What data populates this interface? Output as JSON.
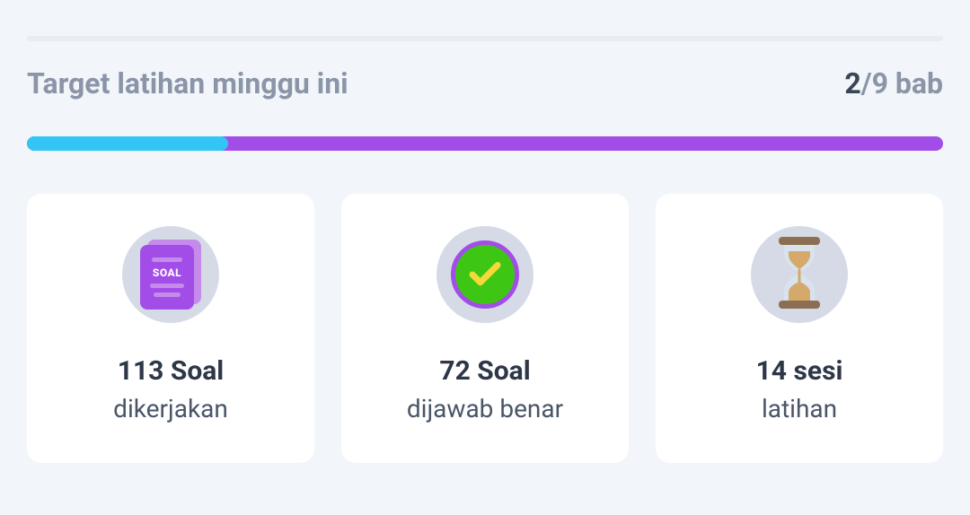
{
  "header": {
    "title": "Target latihan minggu ini",
    "progress_current": "2",
    "progress_total": "/9 bab"
  },
  "progress": {
    "percent": 22
  },
  "cards": [
    {
      "icon": "soal-icon",
      "icon_text": "SOAL",
      "value": "113 Soal",
      "label": "dikerjakan"
    },
    {
      "icon": "check-icon",
      "value": "72 Soal",
      "label": "dijawab benar"
    },
    {
      "icon": "hourglass-icon",
      "value": "14 sesi",
      "label": "latihan"
    }
  ]
}
